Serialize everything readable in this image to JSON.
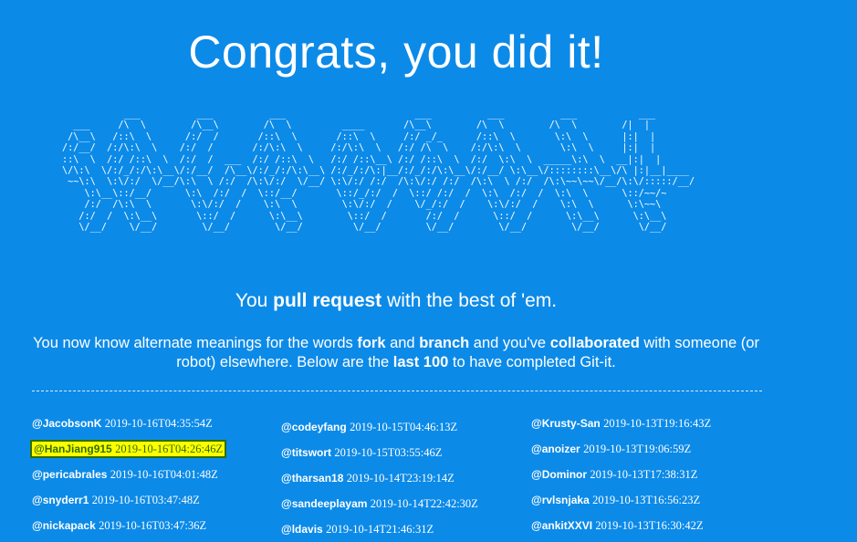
{
  "header": {
    "title": "Congrats, you did it!"
  },
  "ascii_art": "           ___          ___          ___                       ___          ___          ___           ___ \n  ___     /\\  \\        /\\__\\        /\\  \\         ____       /\\__\\        /\\  \\        /\\  \\        /|  |\n /\\__\\   /::\\  \\      /:/  /       /::\\  \\       /::\\  \\     /:/ _/_      /::\\  \\       \\:\\  \\      |:|  |\n/:/__/  /:/\\:\\  \\    /:/  /       /:/\\:\\  \\     /:/\\:\\  \\   /:/ /\\  \\    /:/\\:\\  \\       \\:\\  \\     |:|  |\n::\\  \\  /:/ /::\\  \\  /:/  /  ___  /:/ /::\\  \\   /:/ /::\\__\\ /:/ /::\\  \\  /:/  \\:\\  \\  _____\\:\\  \\  __|:|  |\n\\/\\:\\  \\/:/_/:/\\:\\__\\/:/__/  /\\__\\/:/_/:/\\:\\__\\ /:/_/:/\\:|__/:/_/:/\\:\\__\\/:/__/ \\:\\__\\/::::::::\\__\\/\\ |:|__|____\n ~~\\:\\  \\:\\/:/  \\/__/\\:\\  \\ /:/  /\\:\\/:/  \\/__/ \\:\\/:/ /:/  /\\:\\/:/ /:/  /\\:\\  \\ /:/  /\\:\\~~\\~~\\/__/\\:\\/:::::/__/\n    \\:\\__\\::/__/      \\:\\  /:/  /  \\::/__/       \\::/_/:/  /  \\::/ /:/  /  \\:\\  /:/  /  \\:\\  \\      \\::/~~/~\n    /:/  /\\:\\  \\       \\:\\/:/  /    \\:\\  \\        \\:\\/:/  /    \\/_/:/  /    \\:\\/:/  /    \\:\\  \\      \\:\\~~\\\n   /:/  /  \\:\\__\\       \\::/  /      \\:\\__\\        \\::/  /       /:/  /      \\::/  /      \\:\\__\\      \\:\\__\\\n   \\/__/    \\/__/        \\/__/        \\/__/         \\/__/        \\/__/        \\/__/        \\/__/       \\/__/",
  "tagline": {
    "pre": "You ",
    "bold": "pull request",
    "post": " with the best of 'em."
  },
  "description": {
    "t1": "You now know alternate meanings for the words ",
    "b1": "fork",
    "t2": " and ",
    "b2": "branch",
    "t3": " and you've ",
    "b3": "collaborated",
    "t4": " with someone (or robot) elsewhere. Below are the ",
    "b4": "last 100",
    "t5": " to have completed Git-it."
  },
  "completions": {
    "col1": [
      {
        "user": "@JacobsonK",
        "time": "2019-10-16T04:35:54Z"
      },
      {
        "user": "@HanJiang915",
        "time": "2019-10-16T04:26:46Z",
        "highlighted": true
      },
      {
        "user": "@pericabrales",
        "time": "2019-10-16T04:01:48Z"
      },
      {
        "user": "@snyderr1",
        "time": "2019-10-16T03:47:48Z"
      },
      {
        "user": "@nickapack",
        "time": "2019-10-16T03:47:36Z"
      }
    ],
    "col2": [
      {
        "user": "@codeyfang",
        "time": "2019-10-15T04:46:13Z"
      },
      {
        "user": "@titswort",
        "time": "2019-10-15T03:55:46Z"
      },
      {
        "user": "@tharsan18",
        "time": "2019-10-14T23:19:14Z"
      },
      {
        "user": "@sandeeplayam",
        "time": "2019-10-14T22:42:30Z"
      },
      {
        "user": "@ldavis",
        "time": "2019-10-14T21:46:31Z"
      }
    ],
    "col3": [
      {
        "user": "@Krusty-San",
        "time": "2019-10-13T19:16:43Z"
      },
      {
        "user": "@anoizer",
        "time": "2019-10-13T19:06:59Z"
      },
      {
        "user": "@Dominor",
        "time": "2019-10-13T17:38:31Z"
      },
      {
        "user": "@rvlsnjaka",
        "time": "2019-10-13T16:56:23Z"
      },
      {
        "user": "@ankitXXVI",
        "time": "2019-10-13T16:30:42Z"
      }
    ]
  },
  "colors": {
    "background": "#0c8ae8",
    "text": "#ffffff",
    "highlight": "#ffff00",
    "highlight_text": "#2f6e00"
  }
}
